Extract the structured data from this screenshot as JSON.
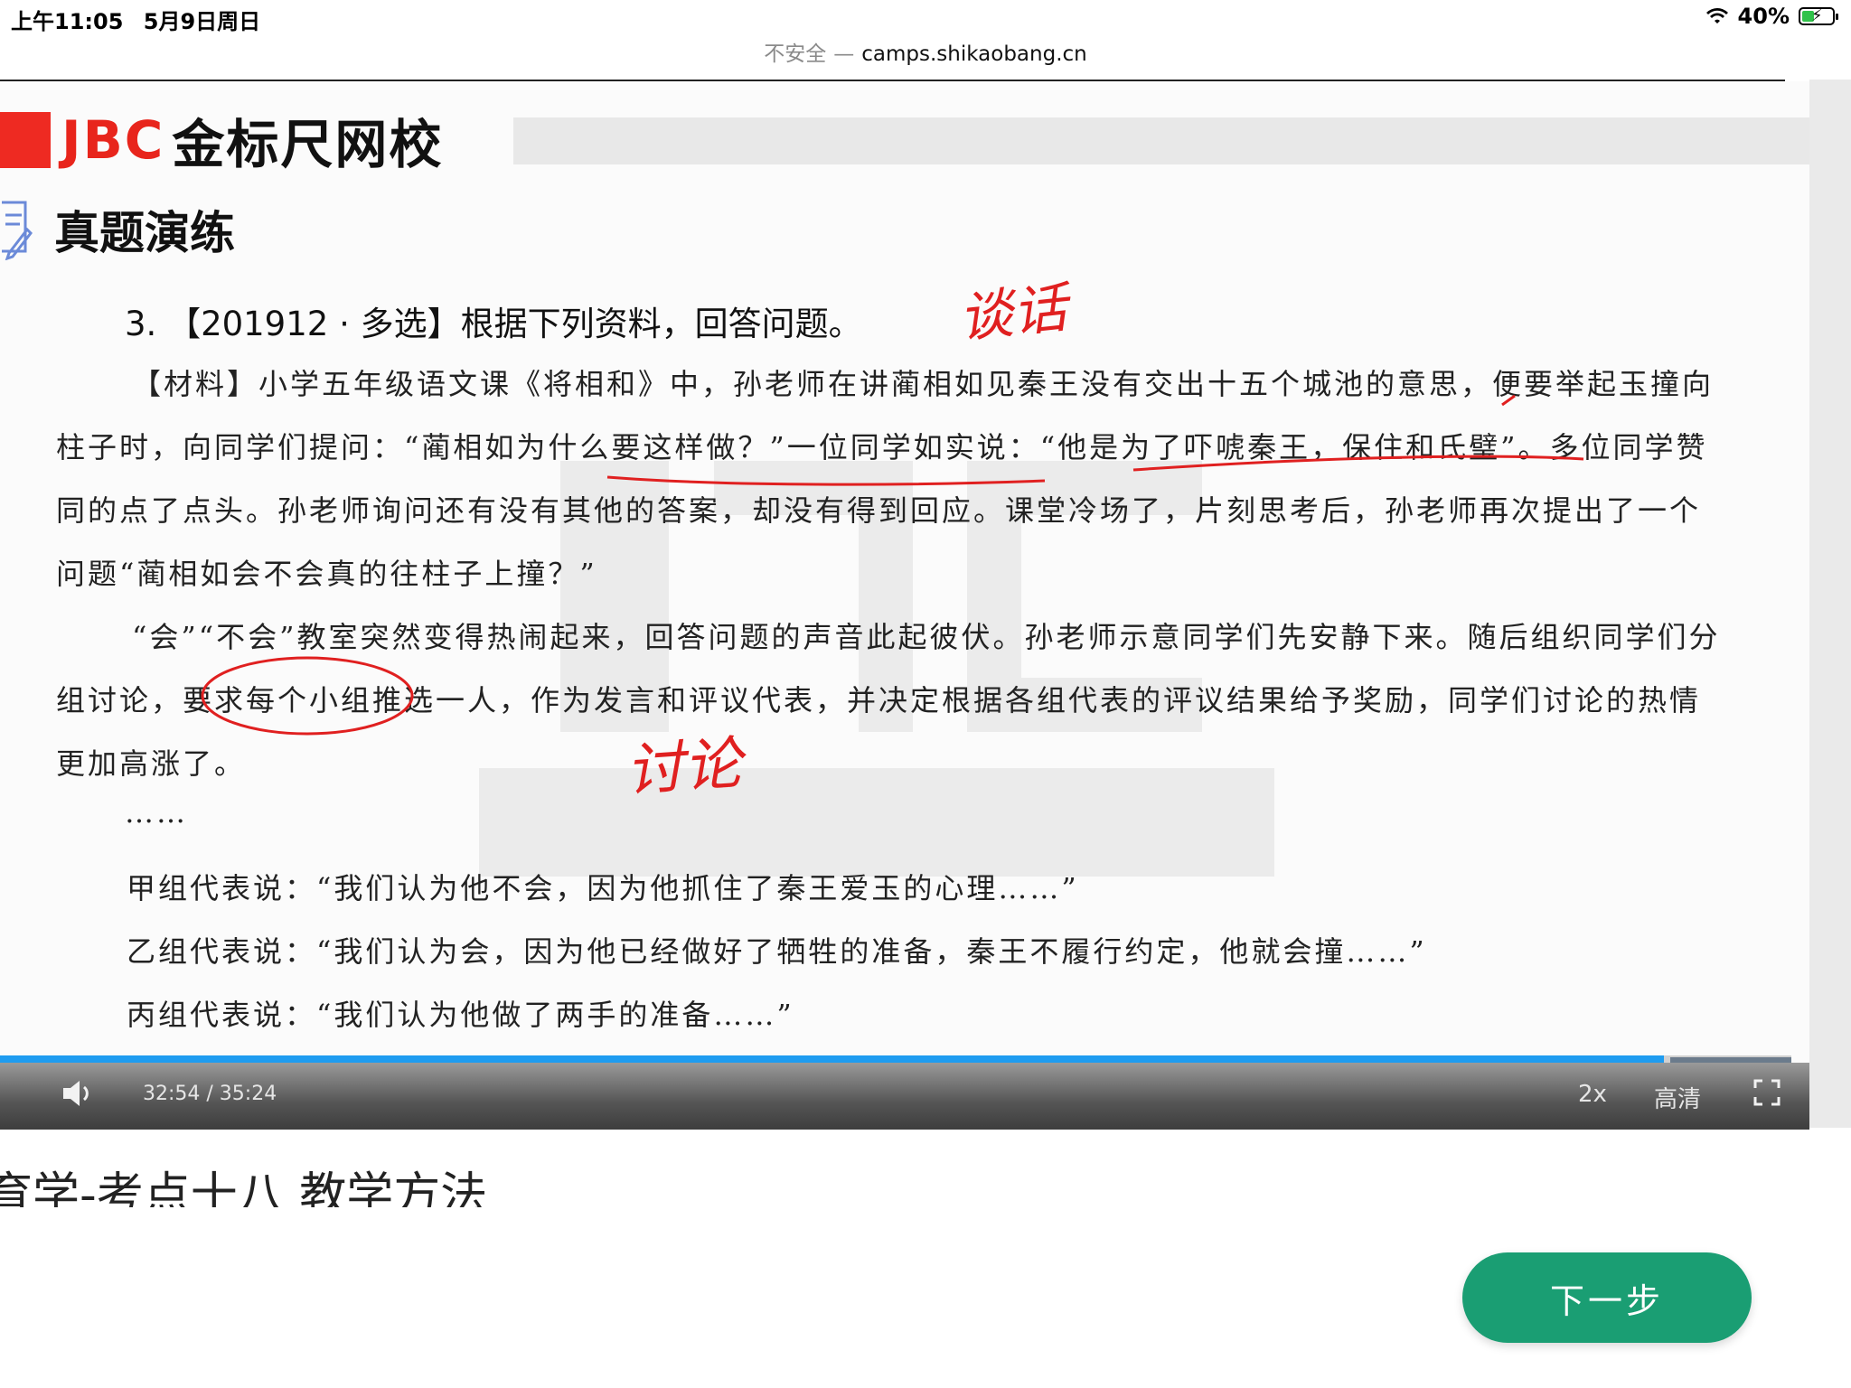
{
  "status_bar": {
    "time": "上午11:05",
    "date": "5月9日周日",
    "battery": "40%",
    "battery_level": 0.4,
    "battery_color": "#30c24a"
  },
  "url_bar": {
    "security": "不安全",
    "separator": "—",
    "host": "camps.shikaobang.cn"
  },
  "slide": {
    "brand_jbc": "JBC",
    "brand_name": "金标尺网校",
    "section_title": "真题演练",
    "question": "3. 【201912 · 多选】根据下列资料，回答问题。",
    "para1": "【材料】小学五年级语文课《将相和》中，孙老师在讲蔺相如见秦王没有交出十五个城池的意思，便要举起玉撞向柱子时，向同学们提问：“蔺相如为什么要这样做？”一位同学如实说：“他是为了吓唬秦王，保住和氏璧”。多位同学赞同的点了点头。孙老师询问还有没有其他的答案，却没有得到回应。课堂冷场了，片刻思考后，孙老师再次提出了一个问题“蔺相如会不会真的往柱子上撞？”",
    "para2": "“会”“不会”教室突然变得热闹起来，回答问题的声音此起彼伏。孙老师示意同学们先安静下来。随后组织同学们分组讨论，要求每个小组推选一人，作为发言和评议代表，并决定根据各组代表的评议结果给予奖励，同学们讨论的热情更加高涨了。",
    "ellipsis1": "……",
    "line_a": "甲组代表说：“我们认为他不会，因为他抓住了秦王爱玉的心理……”",
    "line_b": "乙组代表说：“我们认为会，因为他已经做好了牺牲的准备，秦王不履行约定，他就会撞……”",
    "line_c": "丙组代表说：“我们认为他做了两手的准备……”",
    "ellipsis2": "……",
    "annotation_top": "谈话",
    "annotation_mid": "讨论",
    "annotation_color": "#e02020"
  },
  "player": {
    "time": "32:54 / 35:24",
    "progress": 0.929,
    "speed": "2x",
    "quality": "高清",
    "accent": "#1e9cf0"
  },
  "lesson_title": "育学-考点十八 教学方法",
  "next_button": "下一步",
  "next_button_color": "#1a9e73"
}
